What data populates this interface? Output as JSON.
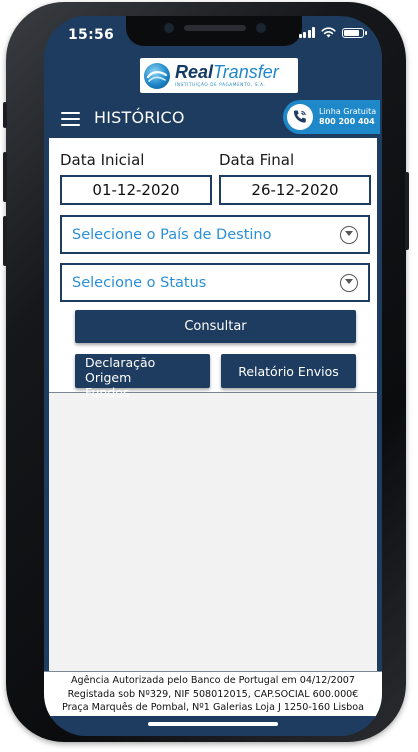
{
  "status_bar": {
    "time": "15:56"
  },
  "logo": {
    "real": "Real",
    "transfer": "Transfer",
    "tagline": "INSTITUIÇÃO DE PAGAMENTO, S.A."
  },
  "header": {
    "title": "HISTÓRICO",
    "hotline_line1": "Linha Gratuita",
    "hotline_number": "800 200 404"
  },
  "filters": {
    "start_label": "Data Inicial",
    "end_label": "Data Final",
    "start_value": "01-12-2020",
    "end_value": "26-12-2020",
    "country_placeholder": "Selecione o País de Destino",
    "status_placeholder": "Selecione o Status"
  },
  "actions": {
    "consult": "Consultar",
    "declaration_line1": "Declaração Origem",
    "declaration_line2": "Fundos",
    "report": "Relatório Envios"
  },
  "footer": {
    "line1": "Agência Autorizada pelo Banco de Portugal em 04/12/2007",
    "line2": "Registada sob Nº329, NIF 508012015, CAP.SOCIAL 600.000€",
    "line3": "Praça Marquês de Pombal, Nº1 Galerias Loja J 1250-160 Lisboa"
  },
  "colors": {
    "brand_navy": "#1d3c5f",
    "brand_blue": "#1e88c9",
    "placeholder_blue": "#2a8fd6"
  },
  "icons": [
    "menu-icon",
    "phone-icon",
    "chevron-down-icon",
    "wifi-icon",
    "battery-icon",
    "signal-icon"
  ]
}
